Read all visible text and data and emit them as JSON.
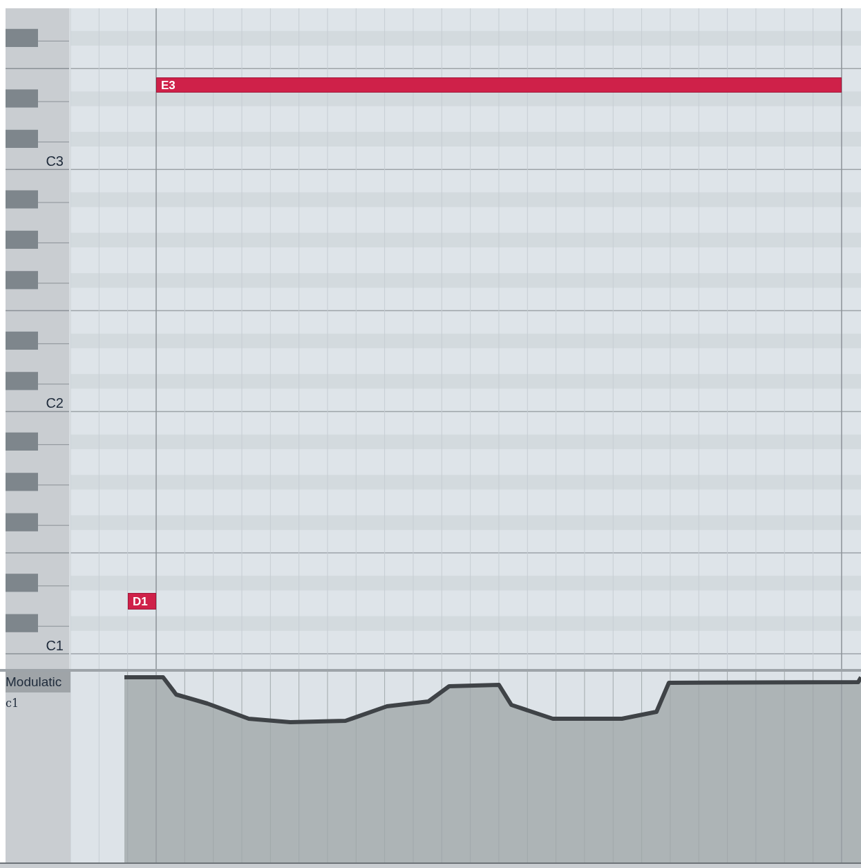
{
  "keyboard": {
    "octave_labels": [
      "C3",
      "C2",
      "C1"
    ]
  },
  "notes": [
    {
      "label": "E3"
    },
    {
      "label": "D1"
    }
  ],
  "controller_lane": {
    "name": "Modulatic",
    "channel": "c1"
  }
}
